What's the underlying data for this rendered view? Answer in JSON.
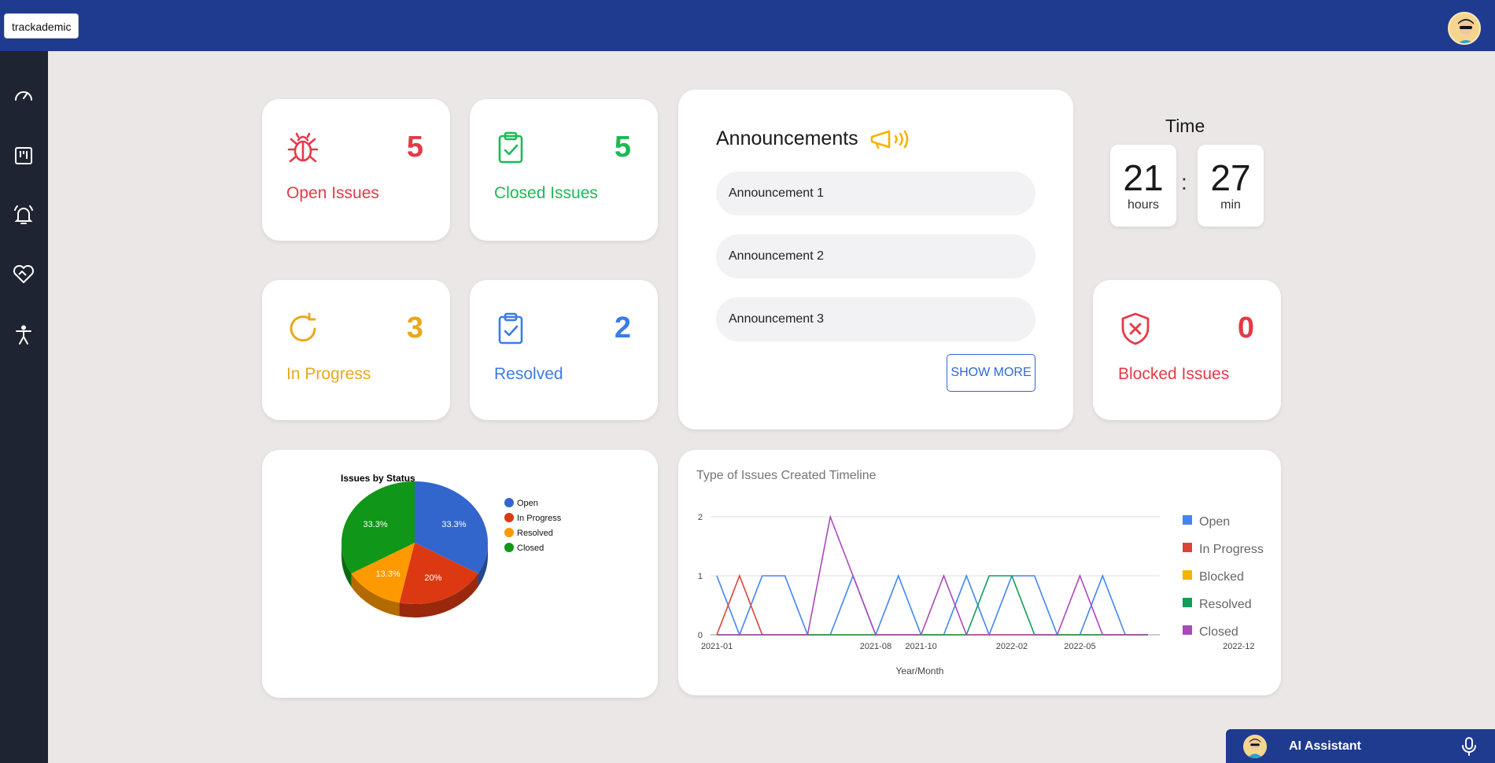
{
  "app": {
    "brand": "trackademic"
  },
  "sidebar": {
    "items": [
      {
        "icon": "dashboard-gauge-icon"
      },
      {
        "icon": "kanban-board-icon"
      },
      {
        "icon": "bell-icon"
      },
      {
        "icon": "handshake-heart-icon"
      },
      {
        "icon": "accessibility-icon"
      }
    ]
  },
  "stats": {
    "open": {
      "value": "5",
      "label": "Open Issues",
      "color": "#e63946",
      "icon": "bug-icon"
    },
    "closed": {
      "value": "5",
      "label": "Closed Issues",
      "color": "#1db954",
      "icon": "clipboard-check-icon"
    },
    "in_progress": {
      "value": "3",
      "label": "In Progress",
      "color": "#e9a81b",
      "icon": "refresh-icon"
    },
    "resolved": {
      "value": "2",
      "label": "Resolved",
      "color": "#3b7be8",
      "icon": "clipboard-check-icon"
    },
    "blocked": {
      "value": "0",
      "label": "Blocked Issues",
      "color": "#e63946",
      "icon": "shield-x-icon"
    }
  },
  "announcements": {
    "title": "Announcements",
    "icon": "megaphone-icon",
    "items": [
      "Announcement 1",
      "Announcement 2",
      "Announcement 3"
    ],
    "show_more": "SHOW MORE"
  },
  "time": {
    "title": "Time",
    "hours": "21",
    "hours_label": "hours",
    "minutes": "27",
    "minutes_label": "min",
    "separator": ":"
  },
  "ai_assistant": {
    "label": "AI Assistant"
  },
  "chart_data": [
    {
      "type": "pie",
      "title": "Issues by Status",
      "categories": [
        "Open",
        "In Progress",
        "Resolved",
        "Closed"
      ],
      "values": [
        33.3,
        20,
        13.3,
        33.3
      ],
      "labels": [
        "33.3%",
        "20%",
        "13.3%",
        "33.3%"
      ],
      "colors": [
        "#3366cc",
        "#dc3912",
        "#ff9900",
        "#109618"
      ],
      "legend": "right"
    },
    {
      "type": "line",
      "title": "Type of Issues Created Timeline",
      "xlabel": "Year/Month",
      "ylabel": "",
      "ylim": [
        0,
        2
      ],
      "yticks": [
        "0",
        "1",
        "2"
      ],
      "x": [
        "2021-01",
        "2021-02",
        "2021-03",
        "2021-04",
        "2021-05",
        "2021-06",
        "2021-07",
        "2021-08",
        "2021-09",
        "2021-10",
        "2021-11",
        "2021-12",
        "2022-01",
        "2022-02",
        "2022-03",
        "2022-04",
        "2022-05",
        "2022-06",
        "2022-07",
        "2022-08",
        "2022-09",
        "2022-10",
        "2022-11",
        "2022-12",
        "2023-01"
      ],
      "xticklabels": [
        "2021-01",
        "2021-08",
        "2021-10",
        "2022-02",
        "2022-05",
        "2022-12"
      ],
      "series": [
        {
          "name": "Open",
          "color": "#4285f4",
          "values": [
            1,
            0,
            1,
            1,
            0,
            0,
            1,
            0,
            1,
            0,
            0,
            1,
            0,
            1,
            1,
            0,
            0,
            1,
            0,
            0
          ]
        },
        {
          "name": "In Progress",
          "color": "#db4437",
          "values": [
            0,
            1,
            0,
            0,
            0,
            0,
            0,
            0,
            0,
            0,
            0,
            0,
            0,
            0,
            0,
            0,
            0,
            0,
            0,
            0
          ]
        },
        {
          "name": "Blocked",
          "color": "#f4b400",
          "values": [
            0,
            0,
            0,
            0,
            0,
            0,
            0,
            0,
            0,
            0,
            0,
            0,
            0,
            0,
            0,
            0,
            0,
            0,
            0,
            0
          ]
        },
        {
          "name": "Resolved",
          "color": "#0f9d58",
          "values": [
            0,
            0,
            0,
            0,
            0,
            0,
            0,
            0,
            0,
            0,
            0,
            0,
            1,
            1,
            0,
            0,
            0,
            0,
            0,
            0
          ]
        },
        {
          "name": "Closed",
          "color": "#ab47bc",
          "values": [
            0,
            0,
            0,
            0,
            0,
            2,
            1,
            0,
            0,
            0,
            1,
            0,
            0,
            0,
            0,
            0,
            1,
            0,
            0,
            0
          ]
        }
      ],
      "legend": "right"
    }
  ]
}
